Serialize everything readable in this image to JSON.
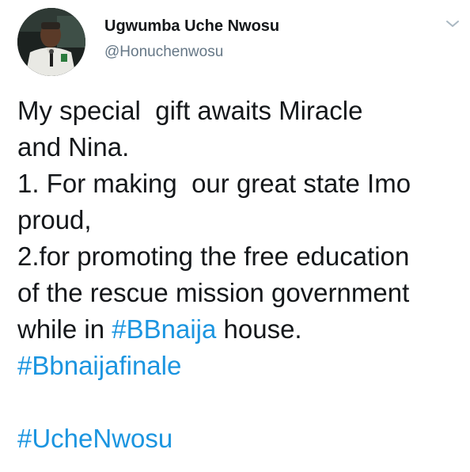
{
  "author": {
    "name": "Ugwumba Uche Nwosu",
    "handle": "@Honuchenwosu"
  },
  "menu_icon": "chevron-down-icon",
  "avatar_icon": "profile-photo",
  "tweet": {
    "line1": "My special  gift awaits Miracle",
    "line2": "and Nina.",
    "line3": "1. For making  our great state Imo",
    "line4": "proud,",
    "line5": "2.for promoting the free education",
    "line6": "of the rescue mission government",
    "line7_pre": "while in ",
    "hashtag_bbnaija": "#BBnaija",
    "line7_post": " house.",
    "hashtag_finale": "#Bbnaijafinale",
    "hashtag_uche": "#UcheNwosu"
  },
  "colors": {
    "text": "#14171a",
    "secondary": "#657786",
    "link": "#1b95e0"
  }
}
